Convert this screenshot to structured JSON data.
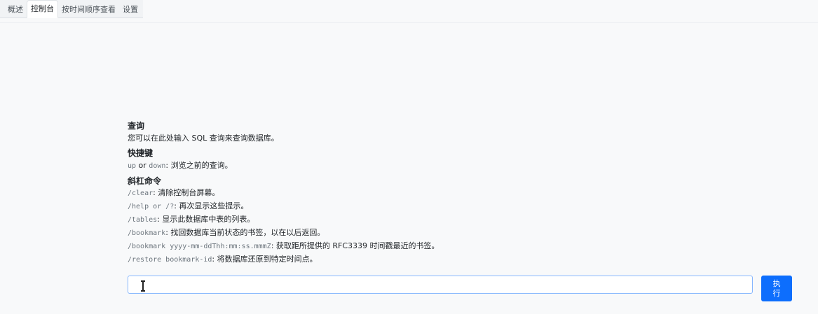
{
  "tabs": [
    {
      "label": "概述",
      "active": false
    },
    {
      "label": "控制台",
      "active": true
    },
    {
      "label": "按时间顺序查看",
      "active": false
    },
    {
      "label": "设置",
      "active": false
    }
  ],
  "help": {
    "query_title": "查询",
    "query_desc": "您可以在此处输入 SQL 查询来查询数据库。",
    "shortcut_title": "快捷键",
    "shortcut_up": "up",
    "shortcut_or": " or ",
    "shortcut_down": "down",
    "shortcut_desc": ": 浏览之前的查询。",
    "slash_title": "斜杠命令",
    "commands": [
      {
        "cmd": "/clear",
        "desc": ": 清除控制台屏幕。"
      },
      {
        "cmd": "/help or /?",
        "desc": ": 再次显示这些提示。"
      },
      {
        "cmd": "/tables",
        "desc": ": 显示此数据库中表的列表。"
      },
      {
        "cmd": "/bookmark",
        "desc": ": 找回数据库当前状态的书签，以在以后返回。"
      },
      {
        "cmd": "/bookmark yyyy-mm-ddThh:mm:ss.mmmZ",
        "desc": ": 获取距所提供的 RFC3339 时间戳最近的书签。"
      },
      {
        "cmd": "/restore bookmark-id",
        "desc": ": 将数据库还原到特定时间点。"
      }
    ]
  },
  "input": {
    "value": "",
    "placeholder": ""
  },
  "run_button": {
    "line1": "执",
    "line2": "行"
  },
  "colors": {
    "accent": "#0d6efd",
    "input_border": "#86b7fe",
    "background": "#f8f9fa"
  }
}
